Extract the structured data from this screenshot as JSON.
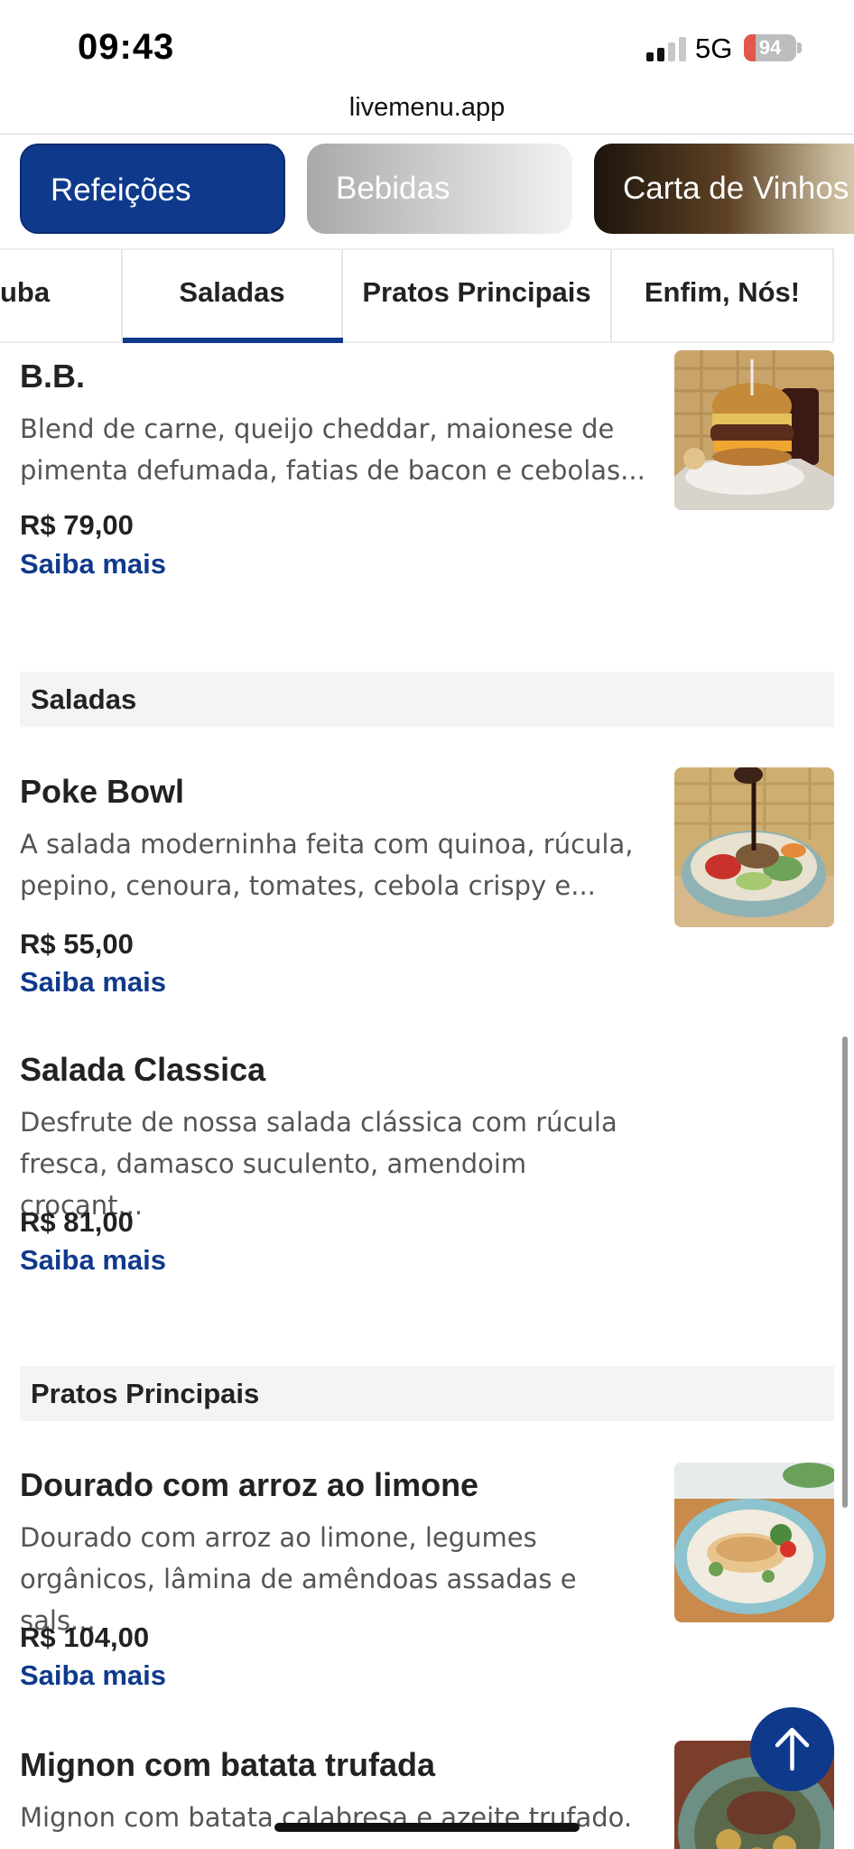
{
  "status_bar": {
    "time": "09:43",
    "network": "5G",
    "battery_level": "94",
    "battery_icon": "battery-charging-icon",
    "signal_icon": "signal-bars-icon"
  },
  "browser": {
    "url": "livemenu.app"
  },
  "categories": [
    {
      "label": "Refeições",
      "active": true
    },
    {
      "label": "Bebidas",
      "active": false
    },
    {
      "label": "Carta de Vinhos",
      "active": false
    }
  ],
  "tabs": [
    {
      "label": "uba"
    },
    {
      "label": "Saladas",
      "active": true
    },
    {
      "label": "Pratos Principais"
    },
    {
      "label": "Enfim, Nós!"
    }
  ],
  "colors": {
    "accent": "#0f3a8c",
    "section_bg": "#f4f4f4"
  },
  "items": [
    {
      "name": "B.B.",
      "desc": "Blend de carne, queijo cheddar, maionese de pimenta defumada, fatias de bacon e cebolas...",
      "price": "R$ 79,00",
      "more": "Saiba mais",
      "image": "burger-photo"
    },
    {
      "name": "Poke Bowl",
      "desc": "A salada moderninha feita com quinoa, rúcula, pepino, cenoura, tomates, cebola crispy e...",
      "price": "R$ 55,00",
      "more": "Saiba mais",
      "image": "poke-bowl-photo"
    },
    {
      "name": " Salada Classica",
      "desc": "Desfrute de nossa salada clássica com rúcula fresca, damasco suculento, amendoim crocant...",
      "price": "R$ 81,00",
      "more": "Saiba mais",
      "image": ""
    },
    {
      "name": "Dourado com arroz ao limone",
      "desc": "Dourado com arroz ao limone, legumes orgânicos, lâmina de amêndoas assadas e sals...",
      "price": "R$ 104,00",
      "more": "Saiba mais",
      "image": "fish-plate-photo"
    },
    {
      "name": "Mignon com batata trufada",
      "desc": "Mignon com batata calabresa e azeite trufado.",
      "image": "mignon-plate-photo"
    }
  ],
  "sections": [
    {
      "title": "Saladas"
    },
    {
      "title": "Pratos Principais"
    }
  ],
  "back_to_top_icon": "arrow-up-icon"
}
